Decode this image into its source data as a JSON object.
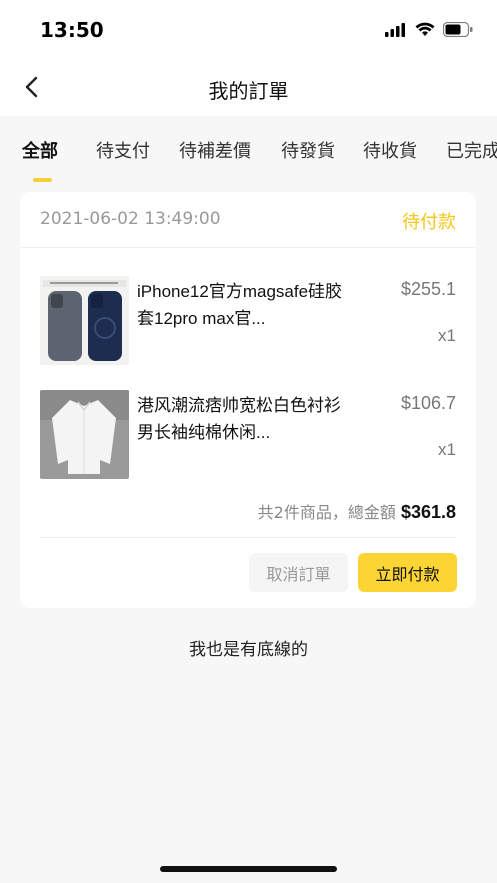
{
  "status_bar": {
    "time": "13:50"
  },
  "nav": {
    "title": "我的訂單"
  },
  "tabs": [
    {
      "label": "全部"
    },
    {
      "label": "待支付"
    },
    {
      "label": "待補差價"
    },
    {
      "label": "待發貨"
    },
    {
      "label": "待收貨"
    },
    {
      "label": "已完成"
    }
  ],
  "active_tab": "全部",
  "order": {
    "datetime": "2021-06-02 13:49:00",
    "status": "待付款",
    "items": [
      {
        "name": "iPhone12官方magsafe硅胶套12pro max官...",
        "price": "$255.1",
        "quantity": "x1",
        "thumbnail": "phone-case-image"
      },
      {
        "name": "港风潮流痞帅宽松白色衬衫男长袖纯棉休闲...",
        "price": "$106.7",
        "quantity": "x1",
        "thumbnail": "white-shirt-image"
      }
    ],
    "summary_label": "共2件商品，總金額",
    "total": "$361.8",
    "cancel_label": "取消訂單",
    "pay_label": "立即付款"
  },
  "bottom_note": "我也是有底線的",
  "colors": {
    "accent": "#fcd535",
    "status": "#f5c518"
  }
}
